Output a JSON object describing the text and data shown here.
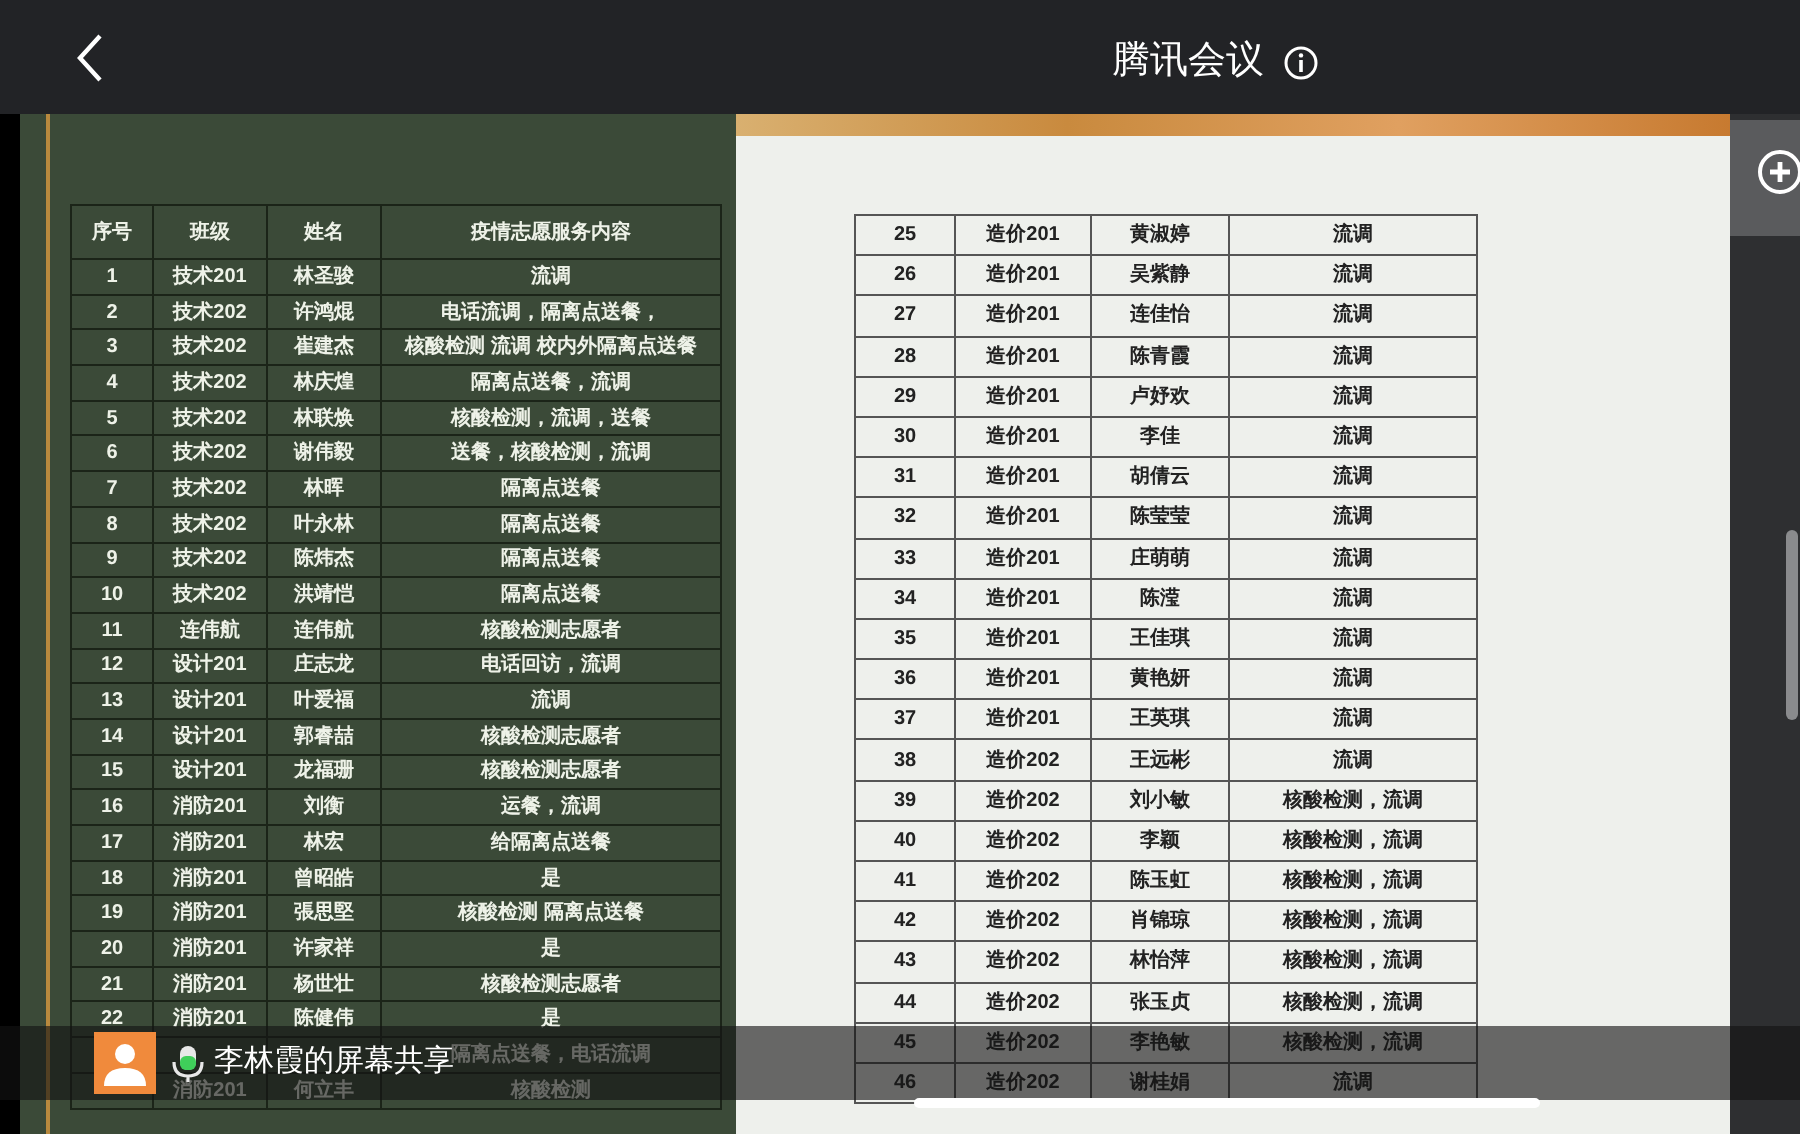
{
  "header": {
    "title": "腾讯会议"
  },
  "left_table": {
    "columns": [
      "序号",
      "班级",
      "姓名",
      "疫情志愿服务内容"
    ],
    "rows": [
      {
        "no": "1",
        "class": "技术201",
        "name": "林圣骏",
        "content": "流调"
      },
      {
        "no": "2",
        "class": "技术202",
        "name": "许鸿焜",
        "content": "电话流调，隔离点送餐，"
      },
      {
        "no": "3",
        "class": "技术202",
        "name": "崔建杰",
        "content": "核酸检测 流调 校内外隔离点送餐"
      },
      {
        "no": "4",
        "class": "技术202",
        "name": "林庆煌",
        "content": "隔离点送餐，流调"
      },
      {
        "no": "5",
        "class": "技术202",
        "name": "林联焕",
        "content": "核酸检测，流调，送餐"
      },
      {
        "no": "6",
        "class": "技术202",
        "name": "谢伟毅",
        "content": "送餐，核酸检测，流调"
      },
      {
        "no": "7",
        "class": "技术202",
        "name": "林晖",
        "content": "隔离点送餐"
      },
      {
        "no": "8",
        "class": "技术202",
        "name": "叶永林",
        "content": "隔离点送餐"
      },
      {
        "no": "9",
        "class": "技术202",
        "name": "陈炜杰",
        "content": "隔离点送餐"
      },
      {
        "no": "10",
        "class": "技术202",
        "name": "洪靖恺",
        "content": "隔离点送餐"
      },
      {
        "no": "11",
        "class": "连伟航",
        "name": "连伟航",
        "content": "核酸检测志愿者"
      },
      {
        "no": "12",
        "class": "设计201",
        "name": "庄志龙",
        "content": "电话回访，流调"
      },
      {
        "no": "13",
        "class": "设计201",
        "name": "叶爱福",
        "content": "流调"
      },
      {
        "no": "14",
        "class": "设计201",
        "name": "郭睿喆",
        "content": "核酸检测志愿者"
      },
      {
        "no": "15",
        "class": "设计201",
        "name": "龙福珊",
        "content": "核酸检测志愿者"
      },
      {
        "no": "16",
        "class": "消防201",
        "name": "刘衡",
        "content": "运餐，流调"
      },
      {
        "no": "17",
        "class": "消防201",
        "name": "林宏",
        "content": "给隔离点送餐"
      },
      {
        "no": "18",
        "class": "消防201",
        "name": "曾昭皓",
        "content": "是"
      },
      {
        "no": "19",
        "class": "消防201",
        "name": "張思堅",
        "content": "核酸检测 隔离点送餐"
      },
      {
        "no": "20",
        "class": "消防201",
        "name": "许家祥",
        "content": "是"
      },
      {
        "no": "21",
        "class": "消防201",
        "name": "杨世壮",
        "content": "核酸检测志愿者"
      },
      {
        "no": "22",
        "class": "消防201",
        "name": "陈健伟",
        "content": "是"
      },
      {
        "content": "隔离点送餐，电话流调"
      },
      {
        "class": "消防201",
        "name": "何立丰",
        "content": "核酸检测"
      }
    ]
  },
  "right_table": {
    "rows": [
      {
        "no": "25",
        "class": "造价201",
        "name": "黄淑婷",
        "content": "流调"
      },
      {
        "no": "26",
        "class": "造价201",
        "name": "吴紫静",
        "content": "流调"
      },
      {
        "no": "27",
        "class": "造价201",
        "name": "连佳怡",
        "content": "流调"
      },
      {
        "no": "28",
        "class": "造价201",
        "name": "陈青霞",
        "content": "流调"
      },
      {
        "no": "29",
        "class": "造价201",
        "name": "卢妤欢",
        "content": "流调"
      },
      {
        "no": "30",
        "class": "造价201",
        "name": "李佳",
        "content": "流调"
      },
      {
        "no": "31",
        "class": "造价201",
        "name": "胡倩云",
        "content": "流调"
      },
      {
        "no": "32",
        "class": "造价201",
        "name": "陈莹莹",
        "content": "流调"
      },
      {
        "no": "33",
        "class": "造价201",
        "name": "庄萌萌",
        "content": "流调"
      },
      {
        "no": "34",
        "class": "造价201",
        "name": "陈滢",
        "content": "流调"
      },
      {
        "no": "35",
        "class": "造价201",
        "name": "王佳琪",
        "content": "流调"
      },
      {
        "no": "36",
        "class": "造价201",
        "name": "黄艳妍",
        "content": "流调"
      },
      {
        "no": "37",
        "class": "造价201",
        "name": "王英琪",
        "content": "流调"
      },
      {
        "no": "38",
        "class": "造价202",
        "name": "王远彬",
        "content": "流调"
      },
      {
        "no": "39",
        "class": "造价202",
        "name": "刘小敏",
        "content": "核酸检测，流调"
      },
      {
        "no": "40",
        "class": "造价202",
        "name": "李颖",
        "content": "核酸检测，流调"
      },
      {
        "no": "41",
        "class": "造价202",
        "name": "陈玉虹",
        "content": "核酸检测，流调"
      },
      {
        "no": "42",
        "class": "造价202",
        "name": "肖锦琼",
        "content": "核酸检测，流调"
      },
      {
        "no": "43",
        "class": "造价202",
        "name": "林怡萍",
        "content": "核酸检测，流调"
      },
      {
        "no": "44",
        "class": "造价202",
        "name": "张玉贞",
        "content": "核酸检测，流调"
      },
      {
        "no": "45",
        "class": "造价202",
        "name": "李艳敏",
        "content": "核酸检测，流调"
      },
      {
        "no": "46",
        "class": "造价202",
        "name": "谢桂娟",
        "content": "流调"
      }
    ]
  },
  "share_banner": {
    "text": "李林霞的屏幕共享"
  }
}
